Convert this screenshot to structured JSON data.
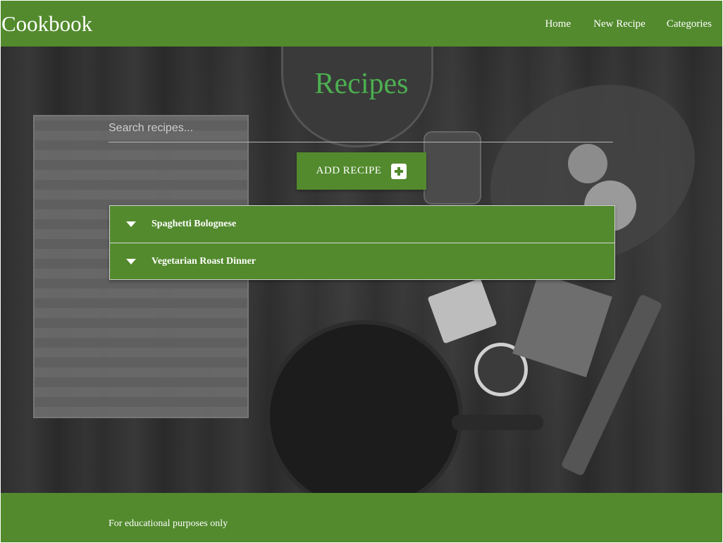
{
  "navbar": {
    "brand": "Cookbook",
    "links": [
      "Home",
      "New Recipe",
      "Categories"
    ]
  },
  "main": {
    "title": "Recipes",
    "search": {
      "placeholder": "Search recipes...",
      "value": ""
    },
    "add_button_label": "ADD RECIPE",
    "recipes": [
      "Spaghetti Bolognese",
      "Vegetarian Roast Dinner"
    ]
  },
  "footer": {
    "text": "For educational purposes only"
  },
  "colors": {
    "primary": "#528a2d",
    "title": "#4caf50"
  },
  "icons": {
    "add": "plus-square-icon",
    "expand": "caret-down-icon"
  }
}
